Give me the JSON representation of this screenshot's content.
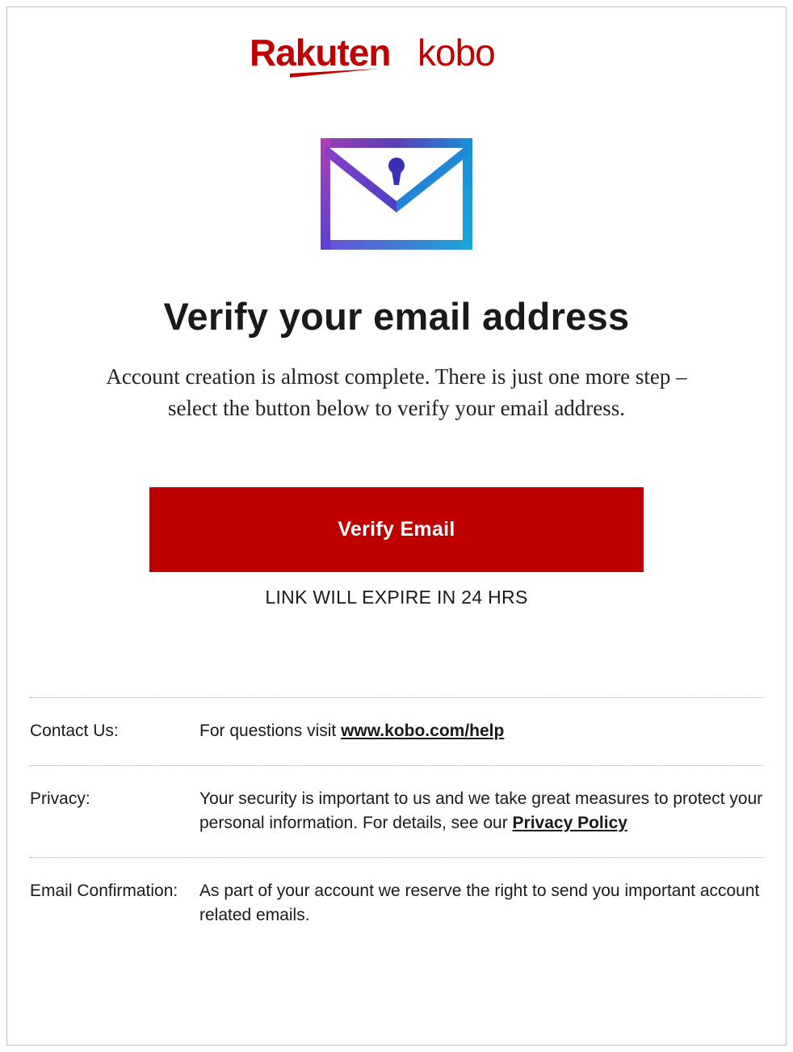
{
  "brand": "Rakuten kobo",
  "icon_name": "envelope-lock-icon",
  "title": "Verify your email address",
  "subtitle": "Account creation is almost complete. There is just one more step – select the button below to verify your email address.",
  "button_label": "Verify Email",
  "expire_text": "LINK WILL EXPIRE IN 24 HRS",
  "footer": {
    "contact": {
      "label": "Contact Us:",
      "text_before": "For questions visit ",
      "link_text": "www.kobo.com/help"
    },
    "privacy": {
      "label": "Privacy:",
      "text_before": "Your security is important to us and we take great measures to protect your personal information. For details, see our ",
      "link_text": "Privacy Policy"
    },
    "email_confirmation": {
      "label": "Email Confirmation:",
      "text": "As part of your account we reserve the right to send you important account related emails."
    }
  },
  "colors": {
    "brand_red": "#bf0000"
  }
}
